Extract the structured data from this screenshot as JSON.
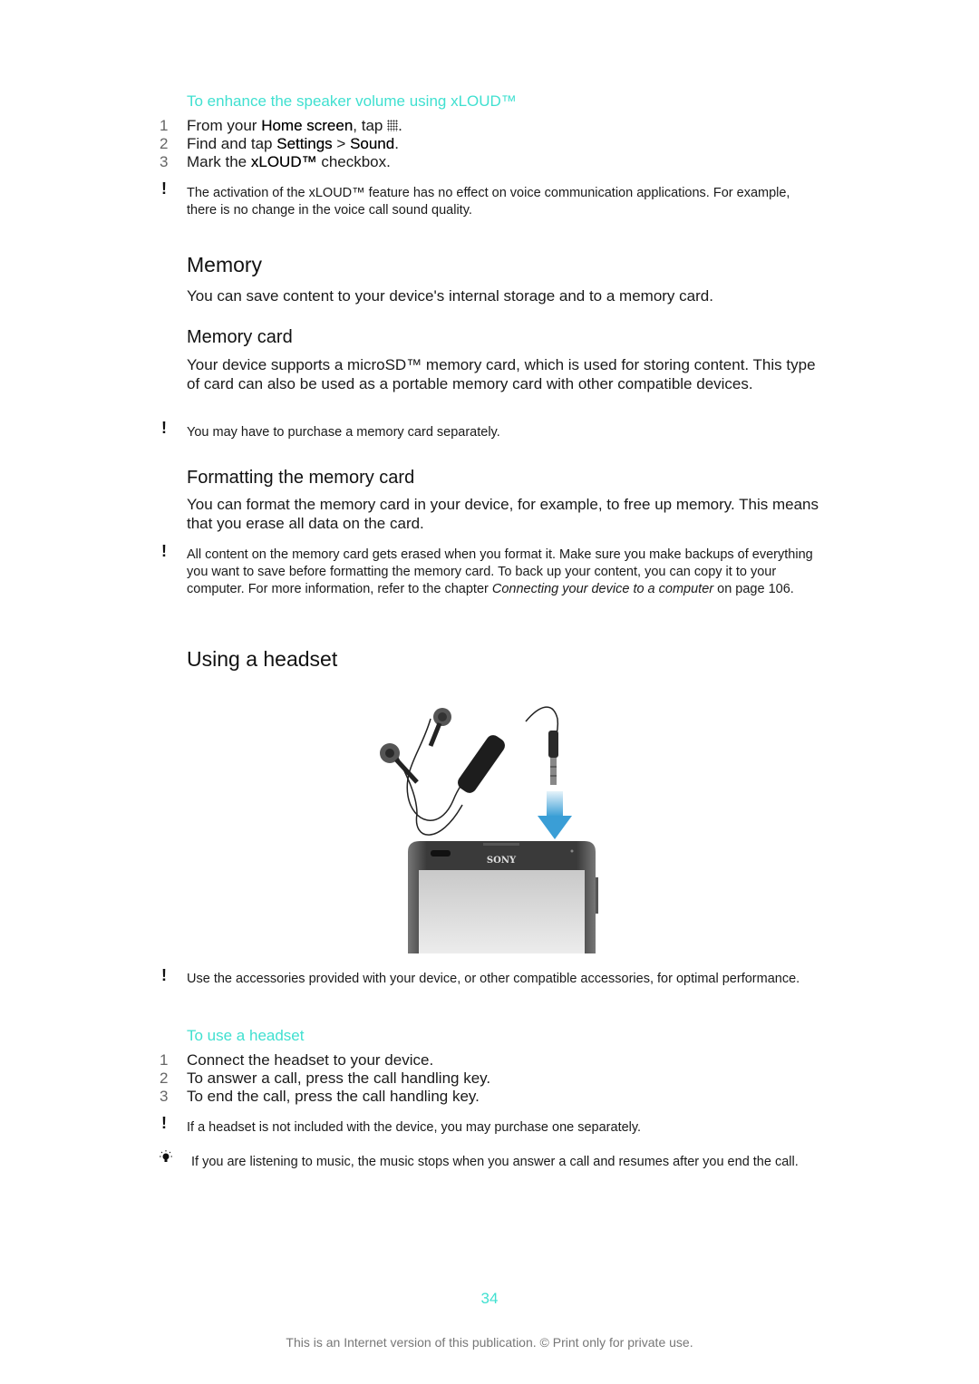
{
  "xloud": {
    "heading": "To enhance the speaker volume using xLOUD™",
    "steps": [
      {
        "num": "1",
        "pre": "From your ",
        "bold": "Home screen",
        "post": ", tap ",
        "icon": "apps-grid-icon",
        "end": "."
      },
      {
        "num": "2",
        "pre": "Find and tap ",
        "bold": "Settings",
        "mid": " > ",
        "bold2": "Sound",
        "end": "."
      },
      {
        "num": "3",
        "pre": "Mark the ",
        "bold": "xLOUD™",
        "end": " checkbox."
      }
    ],
    "note": "The activation of the xLOUD™ feature has no effect on voice communication applications. For example, there is no change in the voice call sound quality."
  },
  "memory": {
    "title": "Memory",
    "intro": "You can save content to your device's internal storage and to a memory card.",
    "card_title": "Memory card",
    "card_text": "Your device supports a microSD™ memory card, which is used for storing content. This type of card can also be used as a portable memory card with other compatible devices.",
    "card_note": "You may have to purchase a memory card separately.",
    "format_title": "Formatting the memory card",
    "format_text": "You can format the memory card in your device, for example, to free up memory. This means that you erase all data on the card.",
    "format_note_pre": "All content on the memory card gets erased when you format it. Make sure you make backups of everything you want to save before formatting the memory card. To back up your content, you can copy it to your computer. For more information, refer to the chapter ",
    "format_note_link": "Connecting your device to a computer",
    "format_note_post": " on page 106."
  },
  "headset": {
    "title": "Using a headset",
    "image_brand": "SONY",
    "note": "Use the accessories provided with your device, or other compatible accessories, for optimal performance.",
    "use_heading": "To use a headset",
    "steps": [
      {
        "num": "1",
        "text": "Connect the headset to your device."
      },
      {
        "num": "2",
        "text": "To answer a call, press the call handling key."
      },
      {
        "num": "3",
        "text": "To end the call, press the call handling key."
      }
    ],
    "purchase_note": "If a headset is not included with the device, you may purchase one separately.",
    "tip": "If you are listening to music, the music stops when you answer a call and resumes after you end the call."
  },
  "footer": {
    "page_number": "34",
    "notice": "This is an Internet version of this publication. © Print only for private use."
  }
}
